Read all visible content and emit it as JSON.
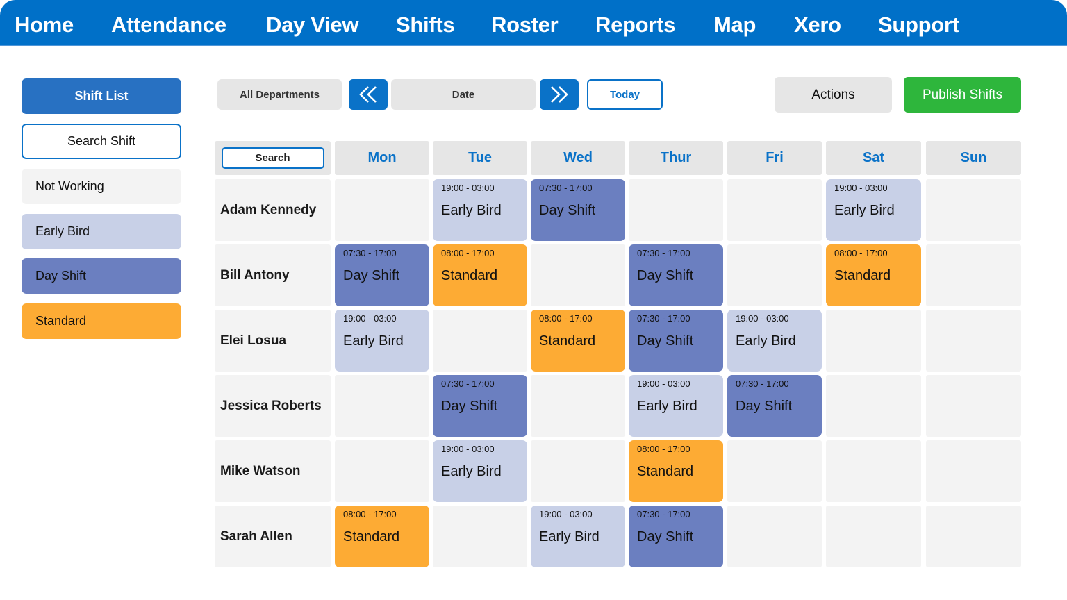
{
  "nav": {
    "items": [
      "Home",
      "Attendance",
      "Day View",
      "Shifts",
      "Roster",
      "Reports",
      "Map",
      "Xero",
      "Support"
    ]
  },
  "sidebar": {
    "shift_list": "Shift List",
    "search_shift": "Search Shift",
    "legend": [
      {
        "label": "Not Working",
        "color": "#f3f3f3"
      },
      {
        "label": "Early Bird",
        "color": "#c8d0e7"
      },
      {
        "label": "Day Shift",
        "color": "#6b7fc0"
      },
      {
        "label": "Standard",
        "color": "#fdab34"
      }
    ]
  },
  "toolbar": {
    "departments": "All Departments",
    "prev_icon": "«",
    "date": "Date",
    "next_icon": "»",
    "today": "Today",
    "actions": "Actions",
    "publish": "Publish Shifts"
  },
  "colors": {
    "primary": "#0070c8",
    "publish": "#2eb63c",
    "early_bird": "#c8d0e7",
    "day_shift": "#6b7fc0",
    "standard": "#fdab34",
    "empty": "#f3f3f3"
  },
  "roster": {
    "search_label": "Search",
    "days": [
      "Mon",
      "Tue",
      "Wed",
      "Thur",
      "Fri",
      "Sat",
      "Sun"
    ],
    "employees": [
      {
        "name": "Adam Kennedy",
        "shifts": [
          null,
          {
            "time": "19:00 - 03:00",
            "type": "Early Bird"
          },
          {
            "time": "07:30 - 17:00",
            "type": "Day Shift"
          },
          null,
          null,
          {
            "time": "19:00 - 03:00",
            "type": "Early Bird"
          },
          null
        ]
      },
      {
        "name": "Bill Antony",
        "shifts": [
          {
            "time": "07:30 - 17:00",
            "type": "Day Shift"
          },
          {
            "time": "08:00 - 17:00",
            "type": "Standard"
          },
          null,
          {
            "time": "07:30 - 17:00",
            "type": "Day Shift"
          },
          null,
          {
            "time": "08:00 - 17:00",
            "type": "Standard"
          },
          null
        ]
      },
      {
        "name": "Elei Losua",
        "shifts": [
          {
            "time": "19:00 - 03:00",
            "type": "Early Bird"
          },
          null,
          {
            "time": "08:00 - 17:00",
            "type": "Standard"
          },
          {
            "time": "07:30 - 17:00",
            "type": "Day Shift"
          },
          {
            "time": "19:00 - 03:00",
            "type": "Early Bird"
          },
          null,
          null
        ]
      },
      {
        "name": "Jessica Roberts",
        "shifts": [
          null,
          {
            "time": "07:30 - 17:00",
            "type": "Day Shift"
          },
          null,
          {
            "time": "19:00 - 03:00",
            "type": "Early Bird"
          },
          {
            "time": "07:30 - 17:00",
            "type": "Day Shift"
          },
          null,
          null
        ]
      },
      {
        "name": "Mike Watson",
        "shifts": [
          null,
          {
            "time": "19:00 - 03:00",
            "type": "Early Bird"
          },
          null,
          {
            "time": "08:00 - 17:00",
            "type": "Standard"
          },
          null,
          null,
          null
        ]
      },
      {
        "name": "Sarah Allen",
        "shifts": [
          {
            "time": "08:00 - 17:00",
            "type": "Standard"
          },
          null,
          {
            "time": "19:00 - 03:00",
            "type": "Early Bird"
          },
          {
            "time": "07:30 - 17:00",
            "type": "Day Shift"
          },
          null,
          null,
          null
        ]
      }
    ]
  }
}
